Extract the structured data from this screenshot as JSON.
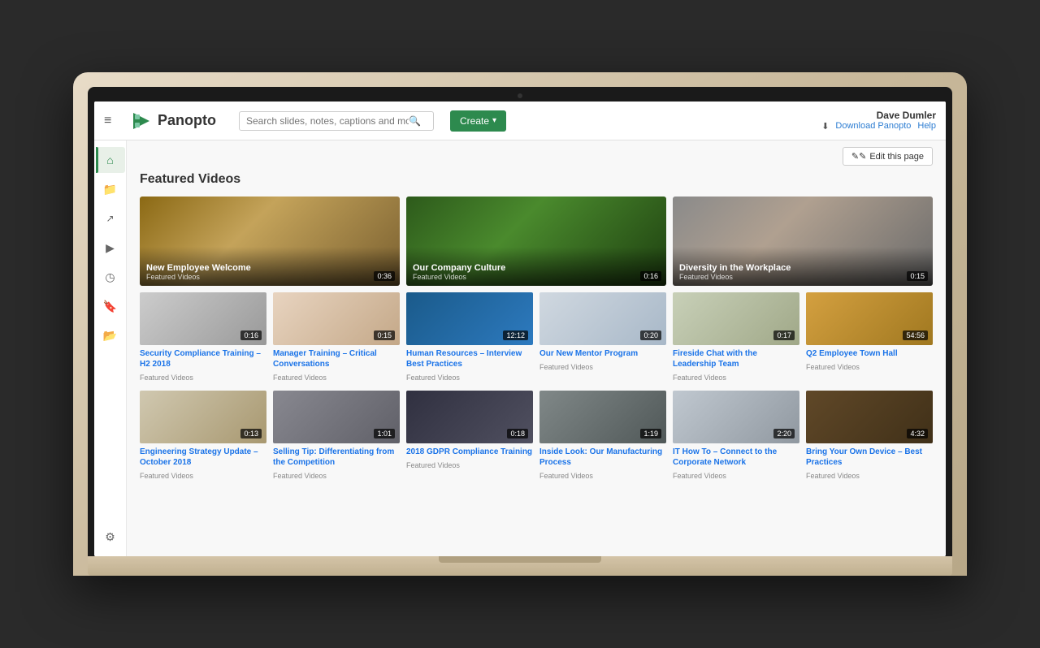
{
  "header": {
    "menu_label": "≡",
    "logo_text": "Panopto",
    "search_placeholder": "Search slides, notes, captions and more",
    "create_label": "Create",
    "user_name": "Dave Dumler",
    "download_label": "Download Panopto",
    "help_label": "Help"
  },
  "edit_bar": {
    "edit_label": "Edit this page"
  },
  "sidebar": {
    "items": [
      {
        "id": "home",
        "icon": "⌂",
        "label": "Home",
        "active": true
      },
      {
        "id": "library",
        "icon": "▶",
        "label": "My Library",
        "active": false
      },
      {
        "id": "share",
        "icon": "↗",
        "label": "Share",
        "active": false
      },
      {
        "id": "videos",
        "icon": "▶",
        "label": "Videos",
        "active": false
      },
      {
        "id": "history",
        "icon": "◷",
        "label": "History",
        "active": false
      },
      {
        "id": "bookmarks",
        "icon": "⊞",
        "label": "Bookmarks",
        "active": false
      },
      {
        "id": "folders",
        "icon": "▭",
        "label": "Folders",
        "active": false
      }
    ],
    "settings": {
      "icon": "⚙",
      "label": "Settings"
    }
  },
  "featured_section": {
    "title": "Featured Videos",
    "top_videos": [
      {
        "id": "new-employee-welcome",
        "title": "New Employee Welcome",
        "category": "Featured Videos",
        "duration": "0:36",
        "thumb_class": "thumb-welcome"
      },
      {
        "id": "company-culture",
        "title": "Our Company Culture",
        "category": "Featured Videos",
        "duration": "0:16",
        "thumb_class": "thumb-culture"
      },
      {
        "id": "diversity-workplace",
        "title": "Diversity in the Workplace",
        "category": "Featured Videos",
        "duration": "0:15",
        "thumb_class": "thumb-diversity"
      }
    ],
    "row2_videos": [
      {
        "id": "security-compliance",
        "title": "Security Compliance Training – H2 2018",
        "category": "Featured Videos",
        "duration": "0:16",
        "thumb_class": "thumb-security"
      },
      {
        "id": "manager-training",
        "title": "Manager Training – Critical Conversations",
        "category": "Featured Videos",
        "duration": "0:15",
        "thumb_class": "thumb-manager"
      },
      {
        "id": "human-resources",
        "title": "Human Resources – Interview Best Practices",
        "category": "Featured Videos",
        "duration": "12:12",
        "thumb_class": "thumb-hr"
      },
      {
        "id": "mentor-program",
        "title": "Our New Mentor Program",
        "category": "Featured Videos",
        "duration": "0:20",
        "thumb_class": "thumb-mentor"
      },
      {
        "id": "fireside-chat",
        "title": "Fireside Chat with the Leadership Team",
        "category": "Featured Videos",
        "duration": "0:17",
        "thumb_class": "thumb-fireside"
      },
      {
        "id": "q2-townhall",
        "title": "Q2 Employee Town Hall",
        "category": "Featured Videos",
        "duration": "54:56",
        "thumb_class": "thumb-townhall"
      }
    ],
    "row3_videos": [
      {
        "id": "engineering-strategy",
        "title": "Engineering Strategy Update – October 2018",
        "category": "Featured Videos",
        "duration": "0:13",
        "thumb_class": "thumb-engineering"
      },
      {
        "id": "selling-tip",
        "title": "Selling Tip: Differentiating from the Competition",
        "category": "Featured Videos",
        "duration": "1:01",
        "thumb_class": "thumb-selling"
      },
      {
        "id": "gdpr-compliance",
        "title": "2018 GDPR Compliance Training",
        "category": "Featured Videos",
        "duration": "0:18",
        "thumb_class": "thumb-gdpr"
      },
      {
        "id": "manufacturing",
        "title": "Inside Look: Our Manufacturing Process",
        "category": "Featured Videos",
        "duration": "1:19",
        "thumb_class": "thumb-inside"
      },
      {
        "id": "it-how-to",
        "title": "IT How To – Connect to the Corporate Network",
        "category": "Featured Videos",
        "duration": "2:20",
        "thumb_class": "thumb-ithowtto"
      },
      {
        "id": "byod",
        "title": "Bring Your Own Device – Best Practices",
        "category": "Featured Videos",
        "duration": "4:32",
        "thumb_class": "thumb-byod"
      }
    ]
  }
}
